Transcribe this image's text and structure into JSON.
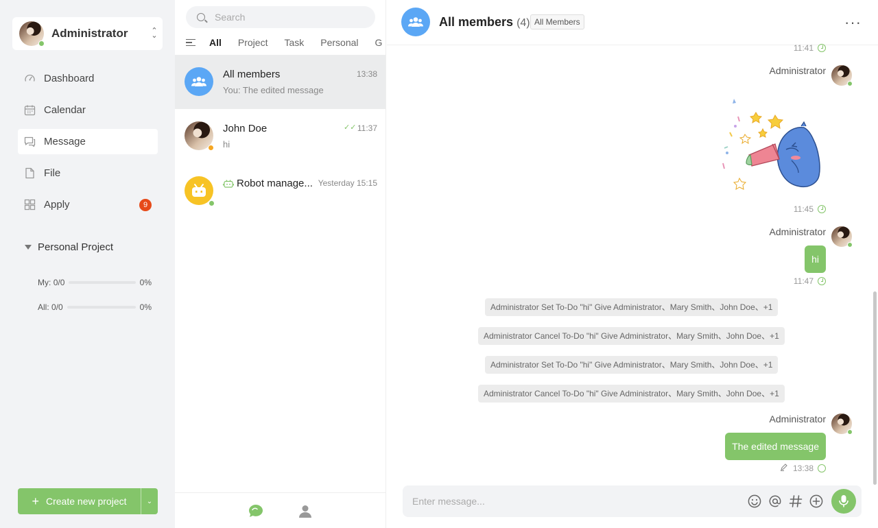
{
  "colors": {
    "accent": "#84c56a",
    "badge": "#e64a19",
    "group_avatar": "#5ba7f5",
    "robot_avatar": "#f7c325"
  },
  "user": {
    "name": "Administrator",
    "status": "online"
  },
  "nav": [
    {
      "label": "Dashboard",
      "icon": "dashboard-icon"
    },
    {
      "label": "Calendar",
      "icon": "calendar-icon"
    },
    {
      "label": "Message",
      "icon": "message-icon",
      "active": true
    },
    {
      "label": "File",
      "icon": "file-icon"
    },
    {
      "label": "Apply",
      "icon": "apps-icon",
      "badge": "9"
    }
  ],
  "project": {
    "heading": "Personal Project",
    "rows": [
      {
        "label": "My:",
        "count": "0/0",
        "percent": "0%",
        "progress": 0
      },
      {
        "label": "All:",
        "count": "0/0",
        "percent": "0%",
        "progress": 0
      }
    ]
  },
  "create_button": {
    "label": "Create new project"
  },
  "search": {
    "placeholder": "Search"
  },
  "tabs": [
    "All",
    "Project",
    "Task",
    "Personal",
    "G"
  ],
  "conversations": [
    {
      "title": "All members",
      "time": "13:38",
      "preview": "You: The edited message"
    },
    {
      "title": "John Doe",
      "time": "11:37",
      "preview": "hi"
    },
    {
      "title": "Robot manage...",
      "time": "Yesterday 15:15",
      "preview": ""
    }
  ],
  "chat": {
    "title": "All members",
    "count": "(4)",
    "tag": "All Members",
    "messages": {
      "time_top": "11:41",
      "sender": "Administrator",
      "sticker_time": "11:45",
      "hi_text": "hi",
      "hi_time": "11:47",
      "edited_text": "The edited message",
      "edited_time": "13:38"
    },
    "notices": [
      "Administrator Set To-Do \"hi\" Give Administrator、Mary Smith、John Doe、+1",
      "Administrator Cancel To-Do \"hi\" Give Administrator、Mary Smith、John Doe、+1",
      "Administrator Set To-Do \"hi\" Give Administrator、Mary Smith、John Doe、+1",
      "Administrator Cancel To-Do \"hi\" Give Administrator、Mary Smith、John Doe、+1"
    ],
    "input_placeholder": "Enter message..."
  }
}
